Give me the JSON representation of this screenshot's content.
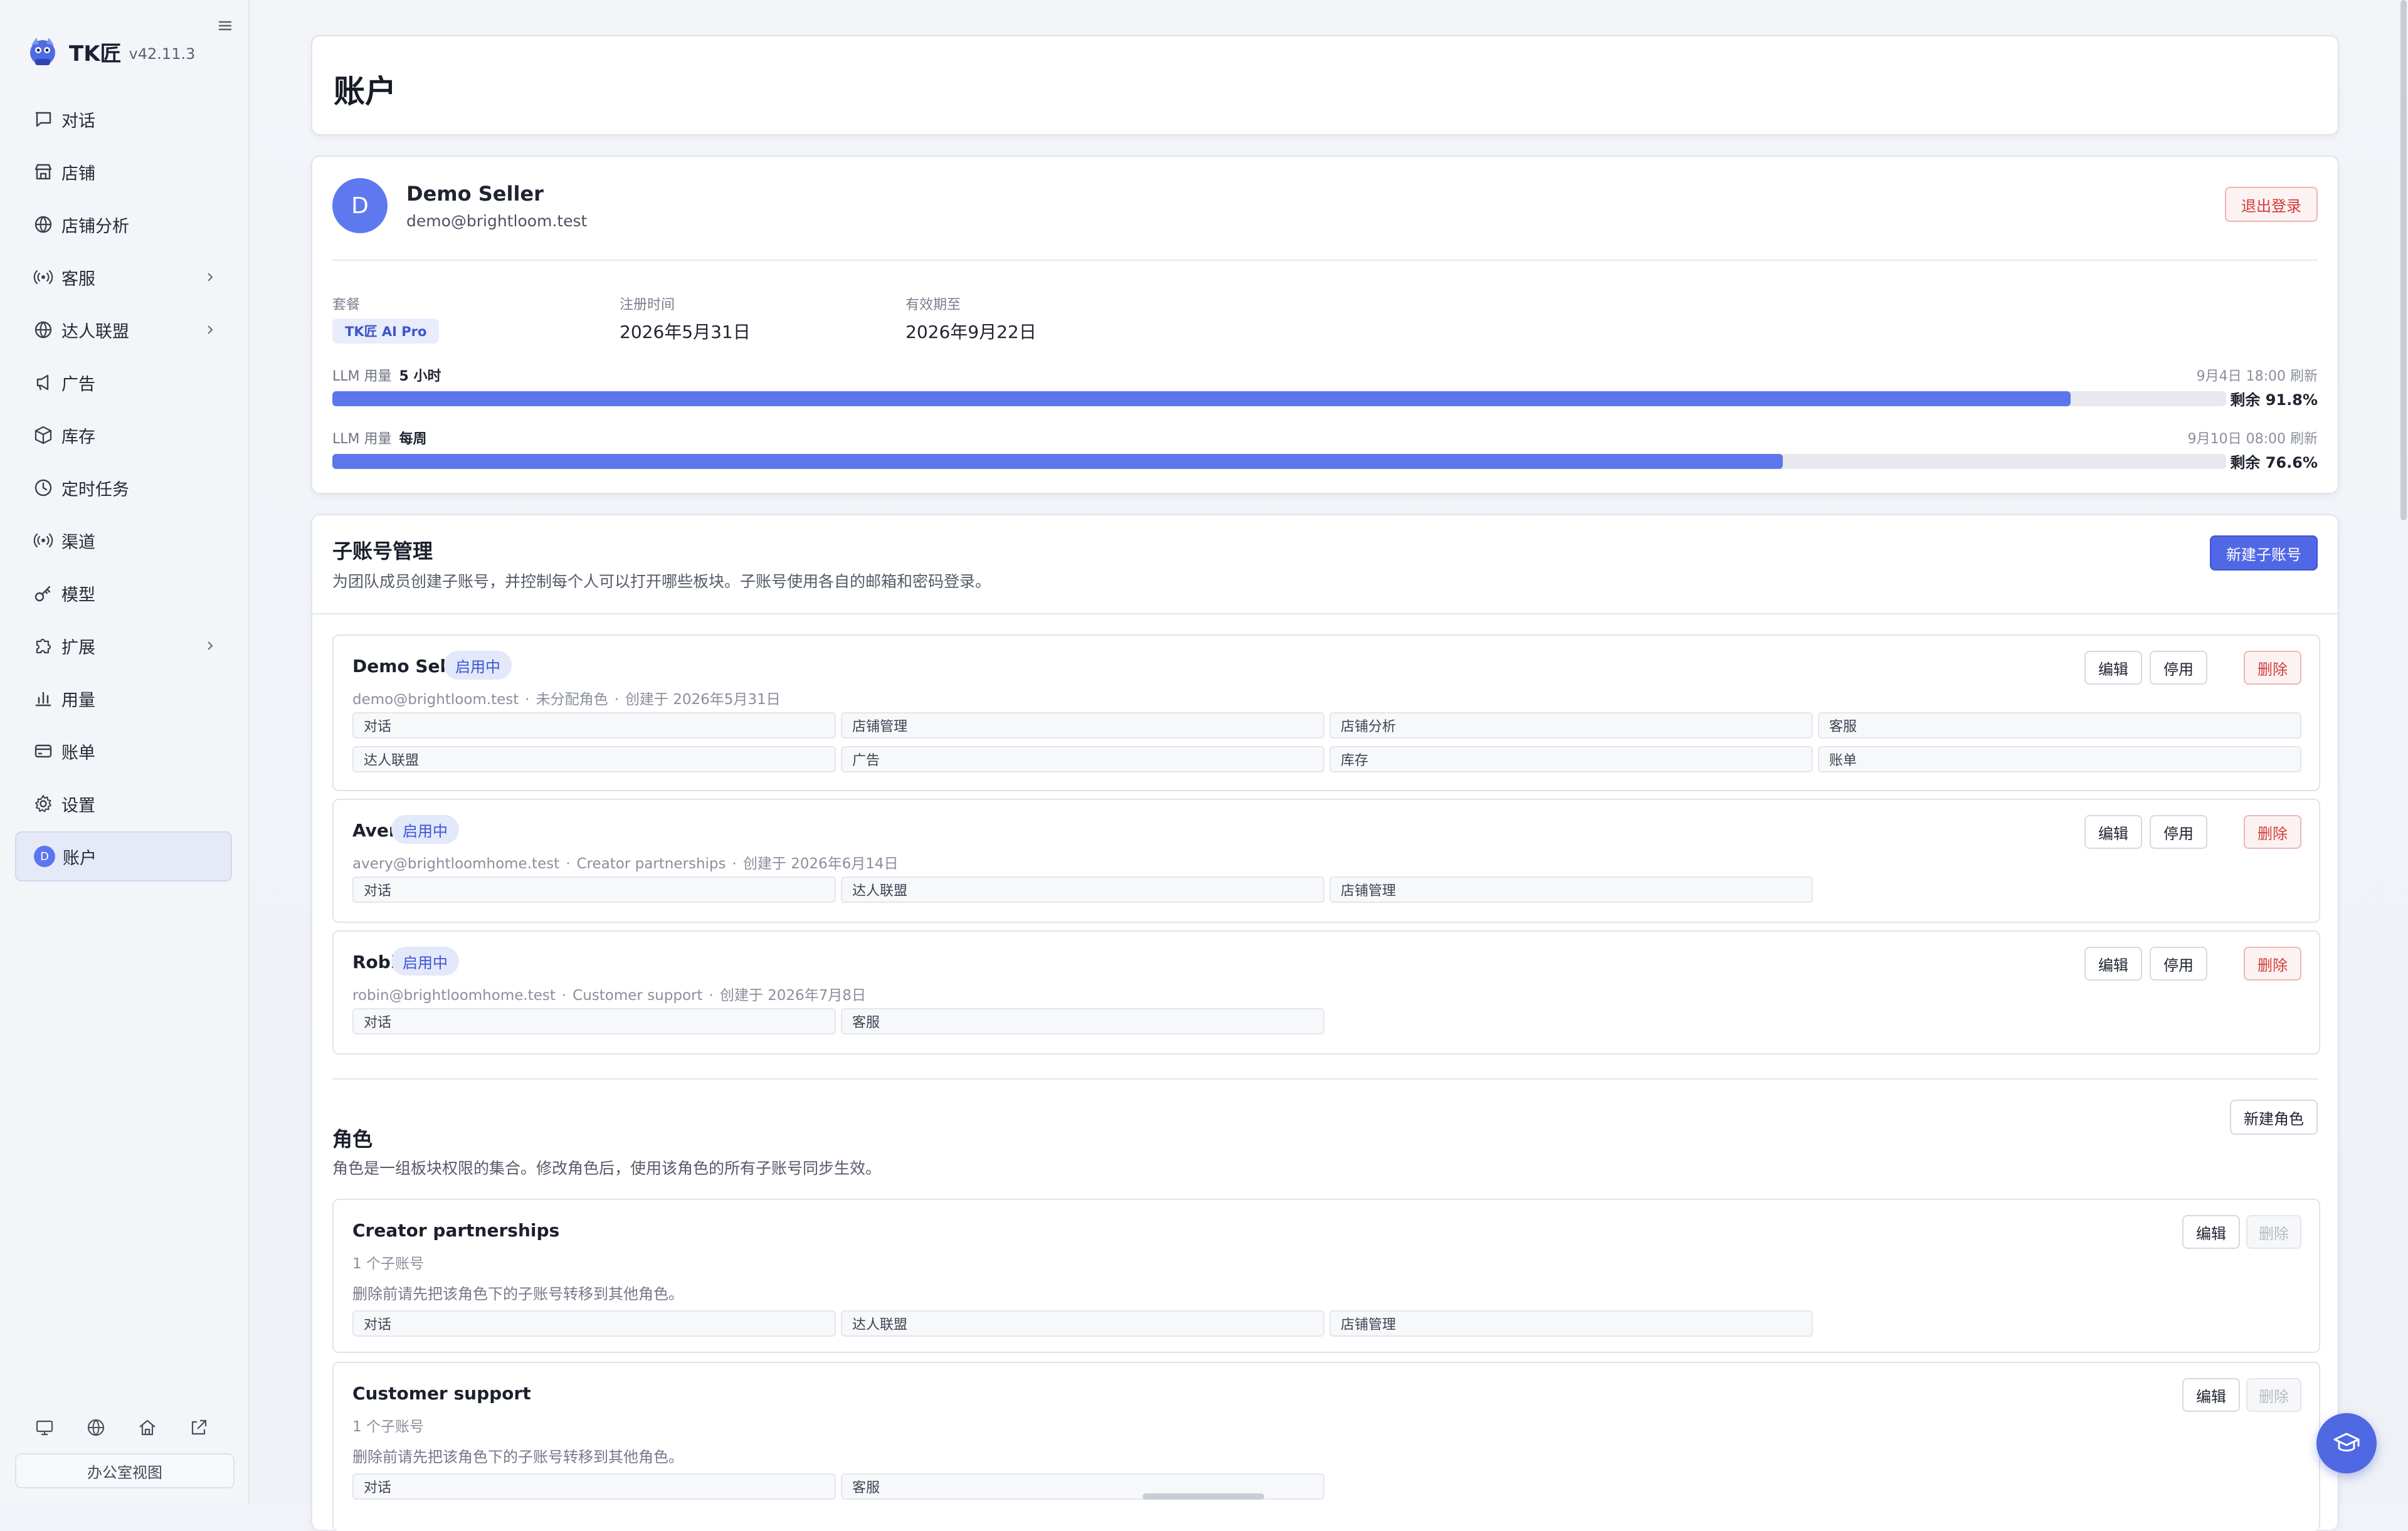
{
  "app": {
    "name": "TK匠",
    "version": "v42.11.3"
  },
  "sidebar": {
    "items": [
      {
        "label": "对话",
        "icon": "chat-icon"
      },
      {
        "label": "店铺",
        "icon": "store-icon"
      },
      {
        "label": "店铺分析",
        "icon": "globe-icon"
      },
      {
        "label": "客服",
        "icon": "broadcast-icon",
        "expandable": true
      },
      {
        "label": "达人联盟",
        "icon": "globe-icon",
        "expandable": true
      },
      {
        "label": "广告",
        "icon": "megaphone-icon"
      },
      {
        "label": "库存",
        "icon": "box-icon"
      },
      {
        "label": "定时任务",
        "icon": "clock-icon"
      },
      {
        "label": "渠道",
        "icon": "broadcast-icon"
      },
      {
        "label": "模型",
        "icon": "key-icon"
      },
      {
        "label": "扩展",
        "icon": "puzzle-icon",
        "expandable": true
      },
      {
        "label": "用量",
        "icon": "bar-chart-icon"
      },
      {
        "label": "账单",
        "icon": "card-icon"
      },
      {
        "label": "设置",
        "icon": "gear-icon"
      },
      {
        "label": "账户",
        "icon": "avatar",
        "avatar_letter": "D",
        "active": true
      }
    ],
    "office_view": "办公室视图"
  },
  "page": {
    "title": "账户"
  },
  "account": {
    "avatar_letter": "D",
    "name": "Demo Seller",
    "email": "demo@brightloom.test",
    "logout": "退出登录",
    "plan_label": "套餐",
    "plan": "TK匠 AI Pro",
    "registered_label": "注册时间",
    "registered": "2026年5月31日",
    "expires_label": "有效期至",
    "expires": "2026年9月22日",
    "usage": [
      {
        "label": "LLM 用量",
        "period": "5 小时",
        "refresh": "9月4日 18:00 刷新",
        "remaining": "剩余 91.8%",
        "fill": 0.918
      },
      {
        "label": "LLM 用量",
        "period": "每周",
        "refresh": "9月10日 08:00 刷新",
        "remaining": "剩余 76.6%",
        "fill": 0.766
      }
    ]
  },
  "subaccounts": {
    "title": "子账号管理",
    "desc": "为团队成员创建子账号，并控制每个人可以打开哪些板块。子账号使用各自的邮箱和密码登录。",
    "new_button": "新建子账号",
    "edit": "编辑",
    "disable": "停用",
    "delete": "删除",
    "list": [
      {
        "name": "Demo Seller",
        "status": "启用中",
        "email": "demo@brightloom.test",
        "role": "未分配角色",
        "created": "创建于 2026年5月31日",
        "perms": [
          "对话",
          "店铺管理",
          "店铺分析",
          "客服",
          "达人联盟",
          "广告",
          "库存",
          "账单"
        ]
      },
      {
        "name": "Avery",
        "status": "启用中",
        "email": "avery@brightloomhome.test",
        "role": "Creator partnerships",
        "created": "创建于 2026年6月14日",
        "perms": [
          "对话",
          "达人联盟",
          "店铺管理"
        ]
      },
      {
        "name": "Robin",
        "status": "启用中",
        "email": "robin@brightloomhome.test",
        "role": "Customer support",
        "created": "创建于 2026年7月8日",
        "perms": [
          "对话",
          "客服"
        ]
      }
    ]
  },
  "roles": {
    "title": "角色",
    "desc": "角色是一组板块权限的集合。修改角色后，使用该角色的所有子账号同步生效。",
    "new_button": "新建角色",
    "edit": "编辑",
    "delete": "删除",
    "list": [
      {
        "name": "Creator partnerships",
        "count": "1 个子账号",
        "note": "删除前请先把该角色下的子账号转移到其他角色。",
        "perms": [
          "对话",
          "达人联盟",
          "店铺管理"
        ]
      },
      {
        "name": "Customer support",
        "count": "1 个子账号",
        "note": "删除前请先把该角色下的子账号转移到其他角色。",
        "perms": [
          "对话",
          "客服"
        ]
      }
    ]
  },
  "colors": {
    "accent": "#5067e6",
    "danger": "#d0403c",
    "badge_bg": "#e3e8fb"
  }
}
